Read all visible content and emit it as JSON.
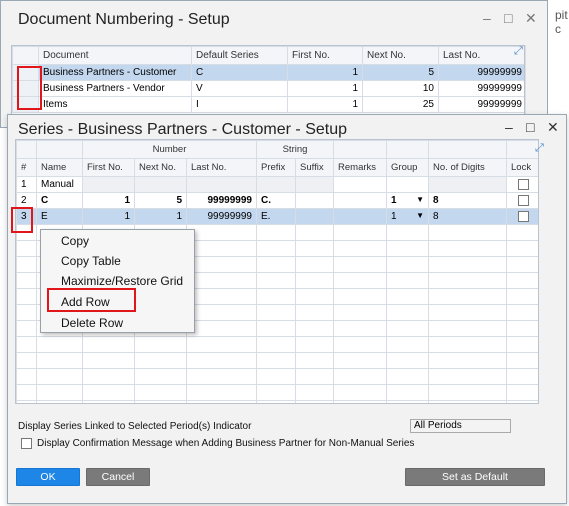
{
  "background_text": "pit c",
  "document_numbering": {
    "title": "Document Numbering - Setup",
    "columns": [
      "Document",
      "Default Series",
      "First No.",
      "Next No.",
      "Last No."
    ],
    "rows": [
      {
        "document": "Business Partners - Customer",
        "default_series": "C",
        "first_no": "1",
        "next_no": "5",
        "last_no": "99999999"
      },
      {
        "document": "Business Partners - Vendor",
        "default_series": "V",
        "first_no": "1",
        "next_no": "10",
        "last_no": "99999999"
      },
      {
        "document": "Items",
        "default_series": "I",
        "first_no": "1",
        "next_no": "25",
        "last_no": "99999999"
      }
    ]
  },
  "series_setup": {
    "title": "Series - Business Partners - Customer - Setup",
    "group_headers": {
      "number": "Number",
      "string": "String"
    },
    "columns": [
      "#",
      "Name",
      "First No.",
      "Next No.",
      "Last No.",
      "Prefix",
      "Suffix",
      "Remarks",
      "Group",
      "No. of Digits",
      "Lock"
    ],
    "rows": [
      {
        "num": "1",
        "name": "Manual",
        "first_no": "",
        "next_no": "",
        "last_no": "",
        "prefix": "",
        "suffix": "",
        "remarks": "",
        "group": "",
        "digits": ""
      },
      {
        "num": "2",
        "name": "C",
        "first_no": "1",
        "next_no": "5",
        "last_no": "99999999",
        "prefix": "C.",
        "suffix": "",
        "remarks": "",
        "group": "1",
        "digits": "8"
      },
      {
        "num": "3",
        "name": "E",
        "first_no": "1",
        "next_no": "1",
        "last_no": "99999999",
        "prefix": "E.",
        "suffix": "",
        "remarks": "",
        "group": "1",
        "digits": "8"
      }
    ]
  },
  "context_menu": {
    "items": [
      "Copy",
      "Copy Table",
      "Maximize/Restore Grid",
      "Add Row",
      "Delete Row"
    ]
  },
  "footer": {
    "period_label": "Display Series Linked to Selected Period(s) Indicator",
    "period_value": "All Periods",
    "confirm_label": "Display Confirmation Message when Adding Business Partner for Non-Manual Series"
  },
  "buttons": {
    "ok": "OK",
    "cancel": "Cancel",
    "set_default": "Set as Default"
  },
  "window_controls": {
    "minimize": "–",
    "maximize": "□",
    "close": "✕"
  }
}
